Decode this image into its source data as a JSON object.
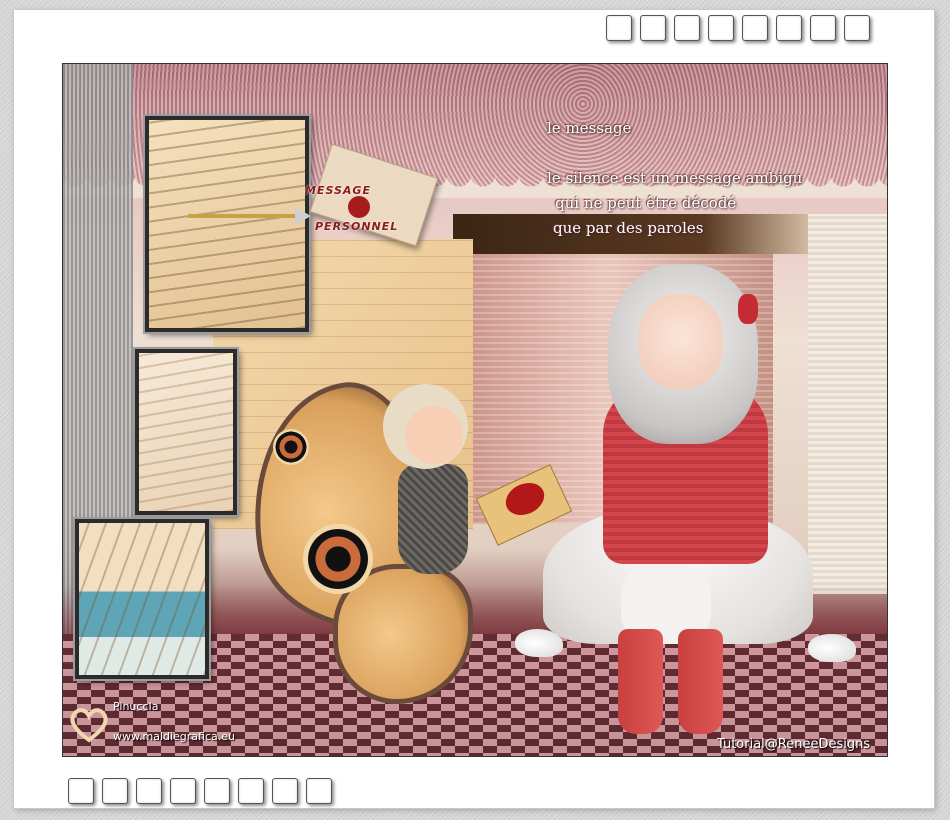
{
  "message": {
    "title": "le message",
    "line1": "le silence est un message ambigu",
    "line2": "qui ne peut être décodé",
    "line3": "que par des paroles"
  },
  "envelope": {
    "word1": "MESSAGE",
    "word2": "PERSONNEL"
  },
  "watermark": {
    "name": "PinuccIa",
    "url": "www.maldiegrafica.eu"
  },
  "credit": "Tutorial@ReneeDesigns",
  "frame": {
    "top_square_count": 8,
    "bottom_square_count": 8
  },
  "colors": {
    "accent_red": "#c42b34",
    "frame_white": "#ffffff"
  }
}
